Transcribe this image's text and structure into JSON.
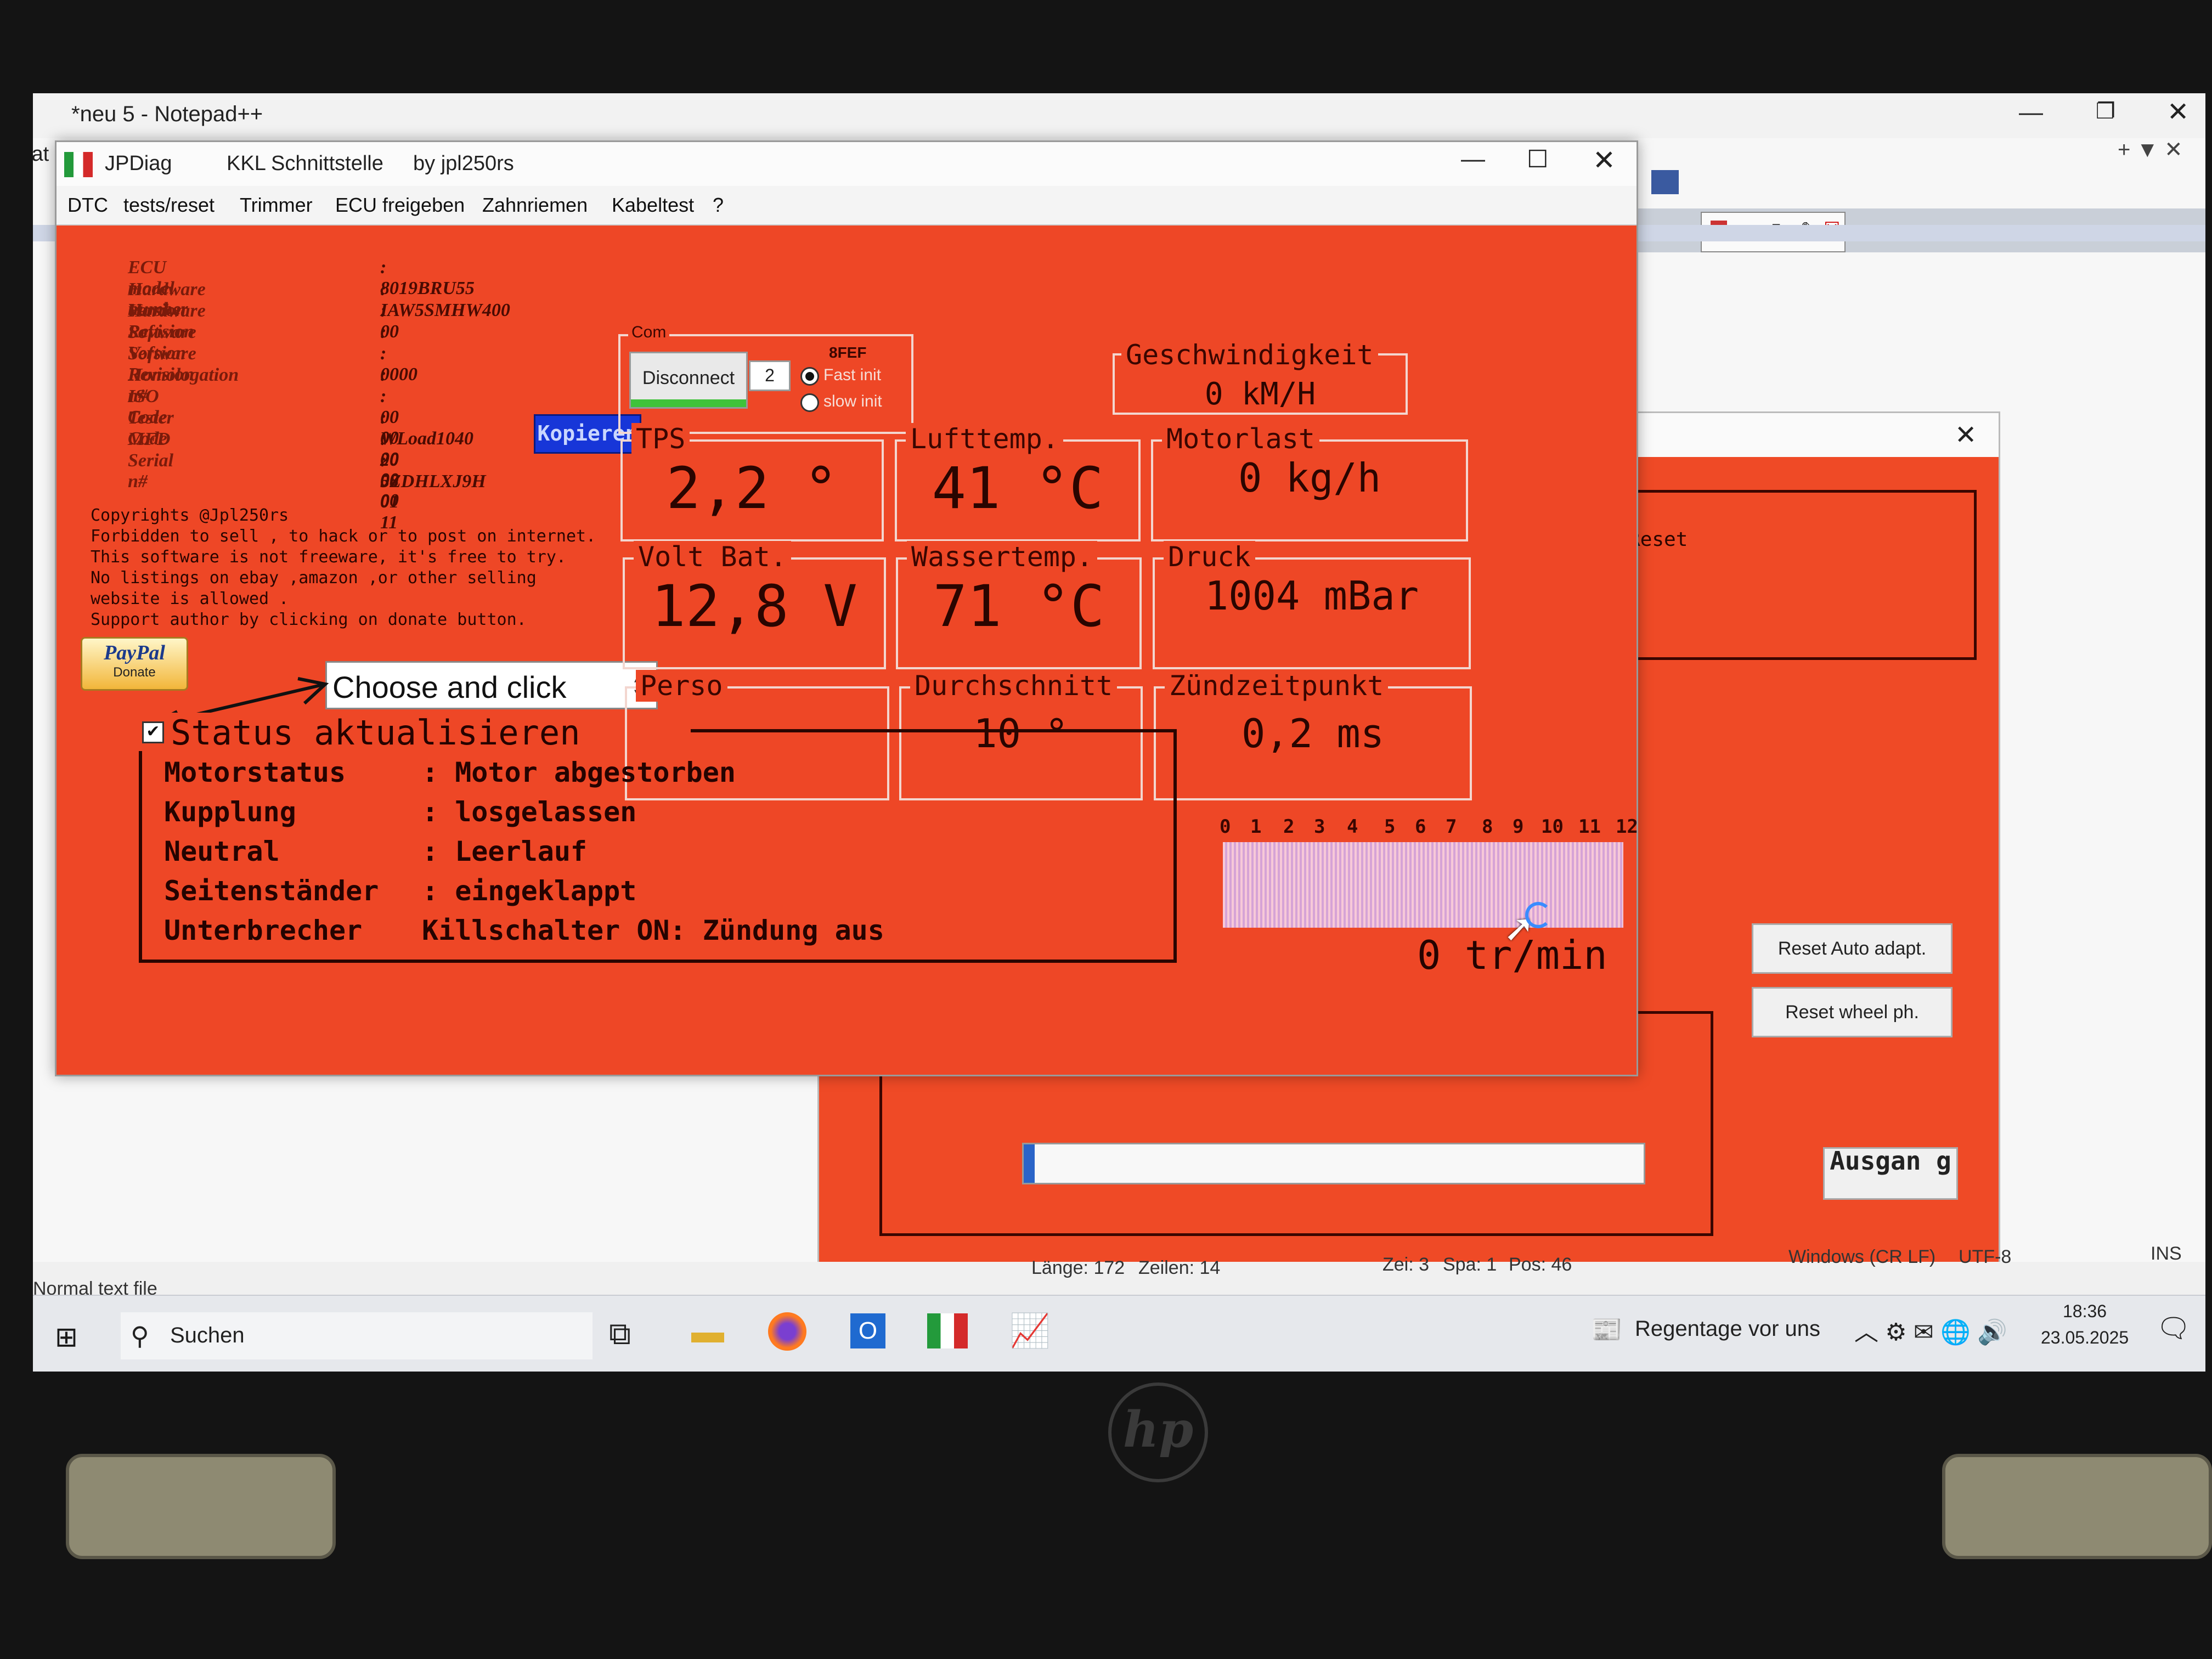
{
  "notepad": {
    "title": "*neu 5 - Notepad++",
    "menu_first": "Dat",
    "tab": "neu 5",
    "status_type": "Normal text file",
    "status_length": "Länge: 172",
    "status_lines": "Zeilen: 14",
    "status_line": "Zei: 3",
    "status_col": "Spa: 1",
    "status_pos": "Pos: 46",
    "status_eol": "Windows (CR LF)",
    "status_enc": "UTF-8",
    "status_ins": "INS"
  },
  "taskbar": {
    "search": "Suchen",
    "weather": "Regentage vor uns",
    "time": "18:36",
    "date": "23.05.2025"
  },
  "dialog2": {
    "reset_text": "ce Reset",
    "partial_text": "et",
    "btn_reset_auto": "Reset Auto adapt.",
    "btn_reset_wheel": "Reset wheel ph.",
    "btn_ausgang": "Ausgan g"
  },
  "jpdiag": {
    "title_app": "JPDiag",
    "title_iface": "KKL Schnittstelle",
    "title_by": "by jpl250rs",
    "menu": [
      "DTC",
      "tests/reset",
      "Trimmer",
      "ECU freigeben",
      "Zahnriemen",
      "Kabeltest",
      "?"
    ],
    "ecu_info": [
      {
        "label": "ECU model number",
        "value": ": 8019BRU55"
      },
      {
        "label": "Hardware Version",
        "value": ": IAW5SMHW400"
      },
      {
        "label": "Hardware Revision",
        "value": ": 00"
      },
      {
        "label": "Software Version",
        "value": ":"
      },
      {
        "label": "Software Revision",
        "value": ": 0000"
      },
      {
        "label": "Homologation n#",
        "value": ":"
      },
      {
        "label": "ISO Code",
        "value": ": 00 00 00 00 00"
      },
      {
        "label": "Tester Code",
        "value": ": WLoad1040"
      },
      {
        "label": "MFD",
        "value": ": 20 08 01 11"
      },
      {
        "label": "Serial n#",
        "value": ": 5ZDHLXJ9H"
      }
    ],
    "copy_button": "Kopieren",
    "copyright": [
      "Copyrights @Jpl250rs",
      "Forbidden to sell , to hack or to post on internet.",
      "This software is not freeware, it's free to try.",
      "No listings on ebay ,amazon ,or other selling",
      "website is allowed .",
      "Support author by clicking on donate button."
    ],
    "paypal": "PayPal",
    "donate": "Donate",
    "choose": "Choose and click",
    "com": {
      "label": "Com",
      "disconnect": "Disconnect",
      "port": "2",
      "code": "8FEF",
      "fast_init": "Fast init",
      "slow_init": "slow init",
      "fast_selected": true
    },
    "gauges": {
      "speed": {
        "label": "Geschwindigkeit",
        "value": "0 kM/H"
      },
      "tps": {
        "label": "TPS",
        "value": "2,2 °"
      },
      "air_temp": {
        "label": "Lufttemp.",
        "value": "41 °C"
      },
      "load": {
        "label": "Motorlast",
        "value": "0 kg/h"
      },
      "volt": {
        "label": "Volt Bat.",
        "value": "12,8 V"
      },
      "water_temp": {
        "label": "Wassertemp.",
        "value": "71 °C"
      },
      "pressure": {
        "label": "Druck",
        "value": "1004 mBar"
      },
      "perso": {
        "label": "Perso",
        "value": ""
      },
      "average": {
        "label": "Durchschnitt",
        "value": "10 °"
      },
      "ignition": {
        "label": "Zündzeitpunkt",
        "value": "0,2 ms"
      }
    },
    "status": {
      "checkbox_label": "Status aktualisieren",
      "checked": true,
      "rows": [
        {
          "label": "Motorstatus",
          "value": ": Motor abgestorben"
        },
        {
          "label": "Kupplung",
          "value": ": losgelassen"
        },
        {
          "label": "Neutral",
          "value": ": Leerlauf"
        },
        {
          "label": "Seitenständer",
          "value": ": eingeklappt"
        },
        {
          "label": "Unterbrecher",
          "value": "Killschalter ON: Zündung aus"
        }
      ]
    },
    "rpm": {
      "ticks": [
        "0",
        "1",
        "2",
        "3",
        "4",
        "5",
        "6",
        "7",
        "8",
        "9",
        "10",
        "11",
        "12"
      ],
      "value": "0 tr/min"
    }
  },
  "laptop": {
    "logo": "hp"
  }
}
